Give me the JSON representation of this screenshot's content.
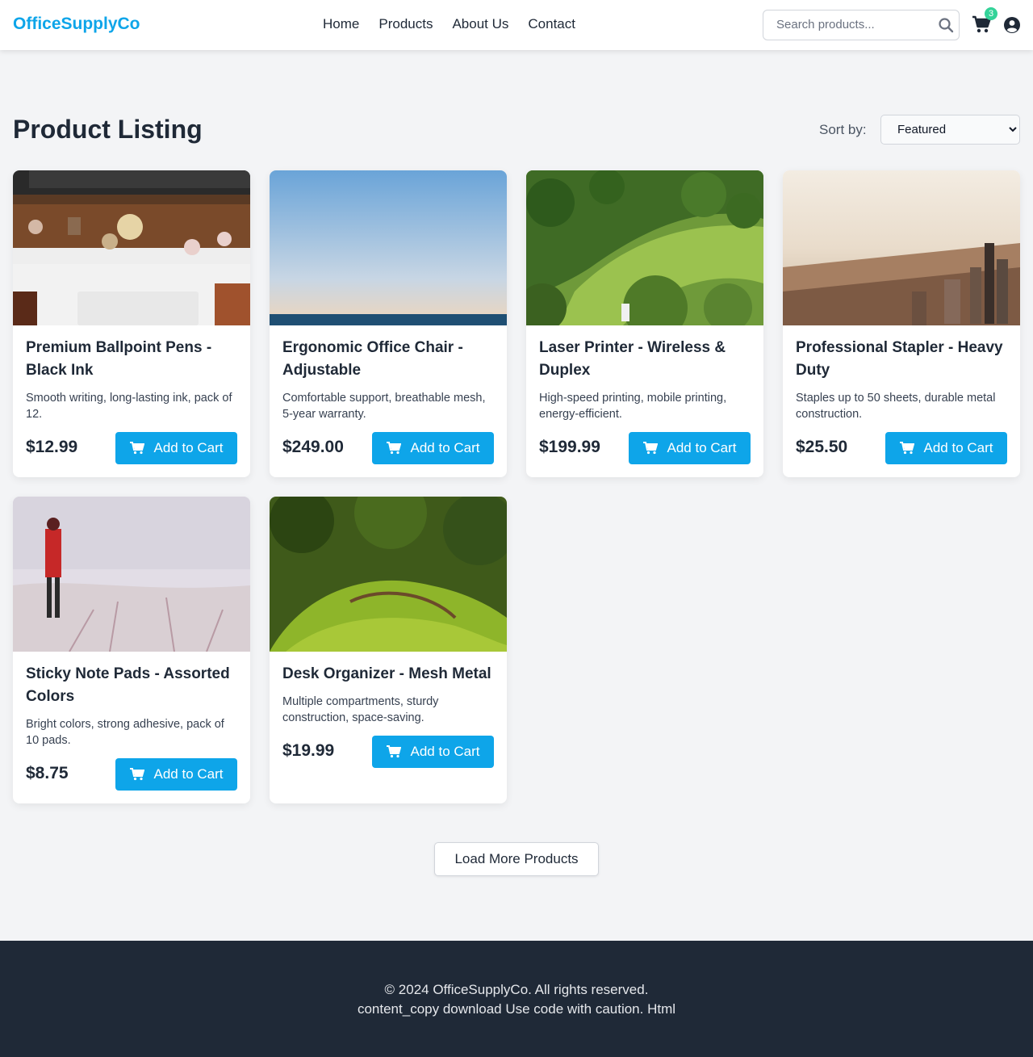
{
  "header": {
    "logo": "OfficeSupplyCo",
    "nav": [
      "Home",
      "Products",
      "About Us",
      "Contact"
    ],
    "search_placeholder": "Search products...",
    "cart_count": "3",
    "colors": {
      "brand": "#0ea5e9",
      "badge": "#34d399"
    }
  },
  "main": {
    "title": "Product Listing",
    "sort_label": "Sort by:",
    "sort_selected": "Featured",
    "add_to_cart_label": "Add to Cart",
    "load_more": "Load More Products",
    "products": [
      {
        "name": "Premium Ballpoint Pens - Black Ink",
        "description": "Smooth writing, long-lasting ink, pack of 12.",
        "price": "$12.99",
        "image": "desk-workspace-photo"
      },
      {
        "name": "Ergonomic Office Chair - Adjustable",
        "description": "Comfortable support, breathable mesh, 5-year warranty.",
        "price": "$249.00",
        "image": "ocean-horizon-photo"
      },
      {
        "name": "Laser Printer - Wireless & Duplex",
        "description": "High-speed printing, mobile printing, energy-efficient.",
        "price": "$199.99",
        "image": "green-hills-photo"
      },
      {
        "name": "Professional Stapler - Heavy Duty",
        "description": "Staples up to 50 sheets, durable metal construction.",
        "price": "$25.50",
        "image": "city-skyline-photo"
      },
      {
        "name": "Sticky Note Pads - Assorted Colors",
        "description": "Bright colors, strong adhesive, pack of 10 pads.",
        "price": "$8.75",
        "image": "snow-person-photo"
      },
      {
        "name": "Desk Organizer - Mesh Metal",
        "description": "Multiple compartments, sturdy construction, space-saving.",
        "price": "$19.99",
        "image": "mossy-forest-photo"
      }
    ]
  },
  "footer": {
    "copyright": "© 2024 OfficeSupplyCo. All rights reserved.",
    "note": "content_copy download Use code with caution. Html"
  }
}
